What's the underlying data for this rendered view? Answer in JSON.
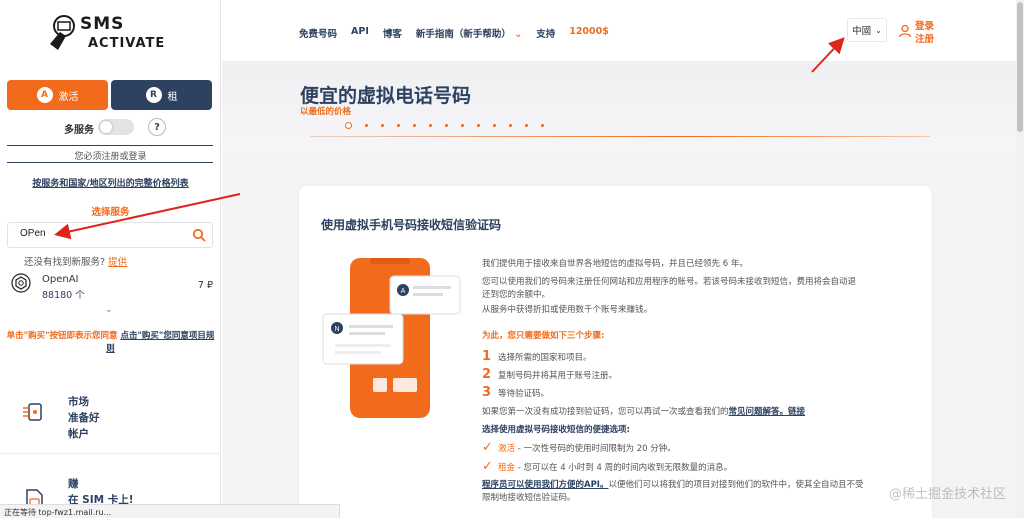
{
  "sidebar": {
    "logo_top": "SMS",
    "logo_bottom": "ACTIVATE",
    "activate_label": "激活",
    "rent_label": "租",
    "multi_service_label": "多服务",
    "help_symbol": "?",
    "must_register": "您必须注册或登录",
    "price_list_link": "按服务和国家/地区列出的完整价格列表",
    "choose_service": "选择服务",
    "search": {
      "value": "OPen",
      "placeholder": ""
    },
    "not_found_text": "还没有找到新服务?",
    "not_found_link": "提供",
    "service": {
      "name": "OpenAI",
      "count": "88180 个",
      "price": "7 ₽"
    },
    "agree_part1": "单击\"购买\"按钮即表示您同意",
    "agree_part2": "点击\"购买\"您同意项目规则",
    "market_lines": [
      "市场",
      "准备好",
      "帐户"
    ],
    "earn_lines": [
      "赚",
      "在 SIM 卡上!"
    ]
  },
  "statusbar": "正在等待 top-fwz1.mail.ru...",
  "header": {
    "nav": [
      "免费号码",
      "API",
      "博客",
      "新手指南（新手帮助）",
      "支持",
      "12000$"
    ],
    "language": "中國",
    "login": "登录",
    "register": "注册"
  },
  "hero": {
    "title": "便宜的虚拟电话号码",
    "subtitle": "以最低的价格"
  },
  "card": {
    "title": "使用虚拟手机号码接收短信验证码",
    "p1": "我们提供用于接收来自世界各地短信的虚拟号码，并且已经领先 6 年。",
    "p2a": "您可以使用我们的号码来注册任何网站和应用程序的账号。若该号码未接收到短信，费用将会自动退",
    "p2b": "还到您的余额中。",
    "p3": "从服务中获得折扣或使用数千个账号来赚钱。",
    "steps_heading": "为此，您只需要做如下三个步骤:",
    "steps": [
      "选择所需的国家和项目。",
      "复制号码并将其用于账号注册。",
      "等待验证码。"
    ],
    "step_numbers": [
      "1",
      "2",
      "3"
    ],
    "first_time_text": "如果您第一次没有成功接到验证码，您可以再试一次或查看我们的",
    "faq_link": "常见问题解答。链接",
    "options_heading": "选择使用虚拟号码接收短信的便捷选项:",
    "option1_label": "激活",
    "option1_text": " - 一次性号码的使用时间限制为 20 分钟。",
    "option2_label": "租金",
    "option2_text": " - 您可以在 4 小时到 4 周的时间内收到无限数量的消息。",
    "api_link": "程序员可以使用我们方便的API。",
    "api_text_a": "以便他们可以将我们的项目对接到他们的软件中，使其全自动且不受",
    "api_text_b": "限制地接收短信验证码。",
    "illus_letters": [
      "A",
      "N"
    ]
  },
  "watermark": "@稀土掘金技术社区",
  "colors": {
    "accent": "#f26b1d",
    "navy": "#2d4260"
  }
}
